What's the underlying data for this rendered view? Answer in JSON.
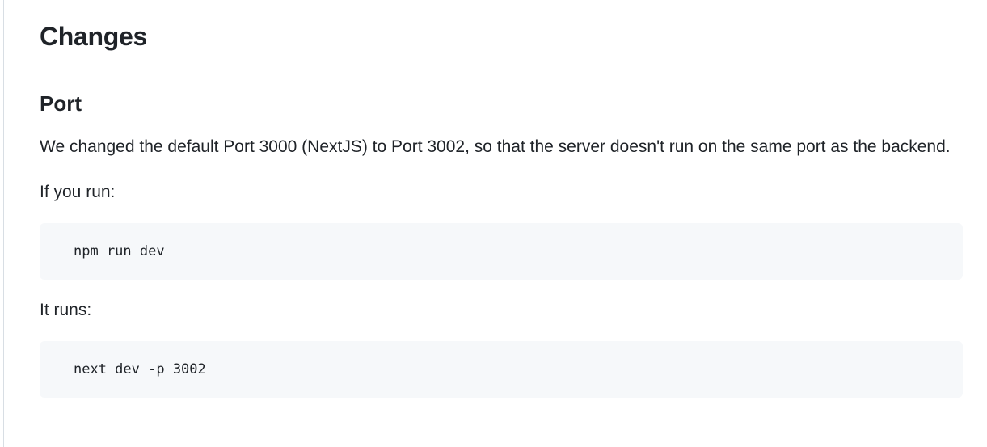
{
  "section": {
    "heading": "Changes",
    "subheading": "Port",
    "paragraph_1": "We changed the default Port 3000 (NextJS) to Port 3002, so that the server doesn't run on the same port as the backend.",
    "paragraph_2": "If you run:",
    "code_1": "npm run dev",
    "paragraph_3": "It runs:",
    "code_2": "next dev -p 3002"
  },
  "colors": {
    "text": "#1f2328",
    "code_background": "#f6f8fa",
    "divider": "#d8dee4"
  }
}
